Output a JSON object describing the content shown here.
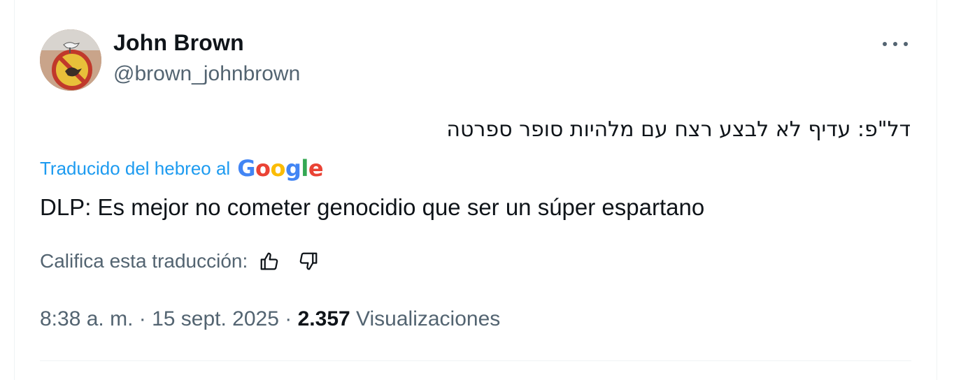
{
  "author": {
    "name": "John Brown",
    "handle": "@brown_johnbrown"
  },
  "tweet": {
    "original_text": "דל\"פ: עדיף לא לבצע רצח עם מלהיות סופר ספרטה",
    "translated_label": "Traducido del hebreo al",
    "google_letters": [
      {
        "char": "G",
        "color": "#4285f4"
      },
      {
        "char": "o",
        "color": "#ea4335"
      },
      {
        "char": "o",
        "color": "#fbbc05"
      },
      {
        "char": "g",
        "color": "#4285f4"
      },
      {
        "char": "l",
        "color": "#34a853"
      },
      {
        "char": "e",
        "color": "#ea4335"
      }
    ],
    "translated_text": "DLP: Es mejor no cometer genocidio que ser un súper espartano",
    "rate_label": "Califica esta traducción:",
    "time": "8:38 a. m.",
    "separator": "·",
    "date": "15 sept. 2025",
    "views_count": "2.357",
    "views_label": "Visualizaciones"
  },
  "icons": {
    "more": "more-horizontal-icon",
    "like": "thumbs-up-icon",
    "dislike": "thumbs-down-icon"
  },
  "colors": {
    "text": "#0f1419",
    "secondary": "#536471",
    "link": "#1d9bf0"
  }
}
